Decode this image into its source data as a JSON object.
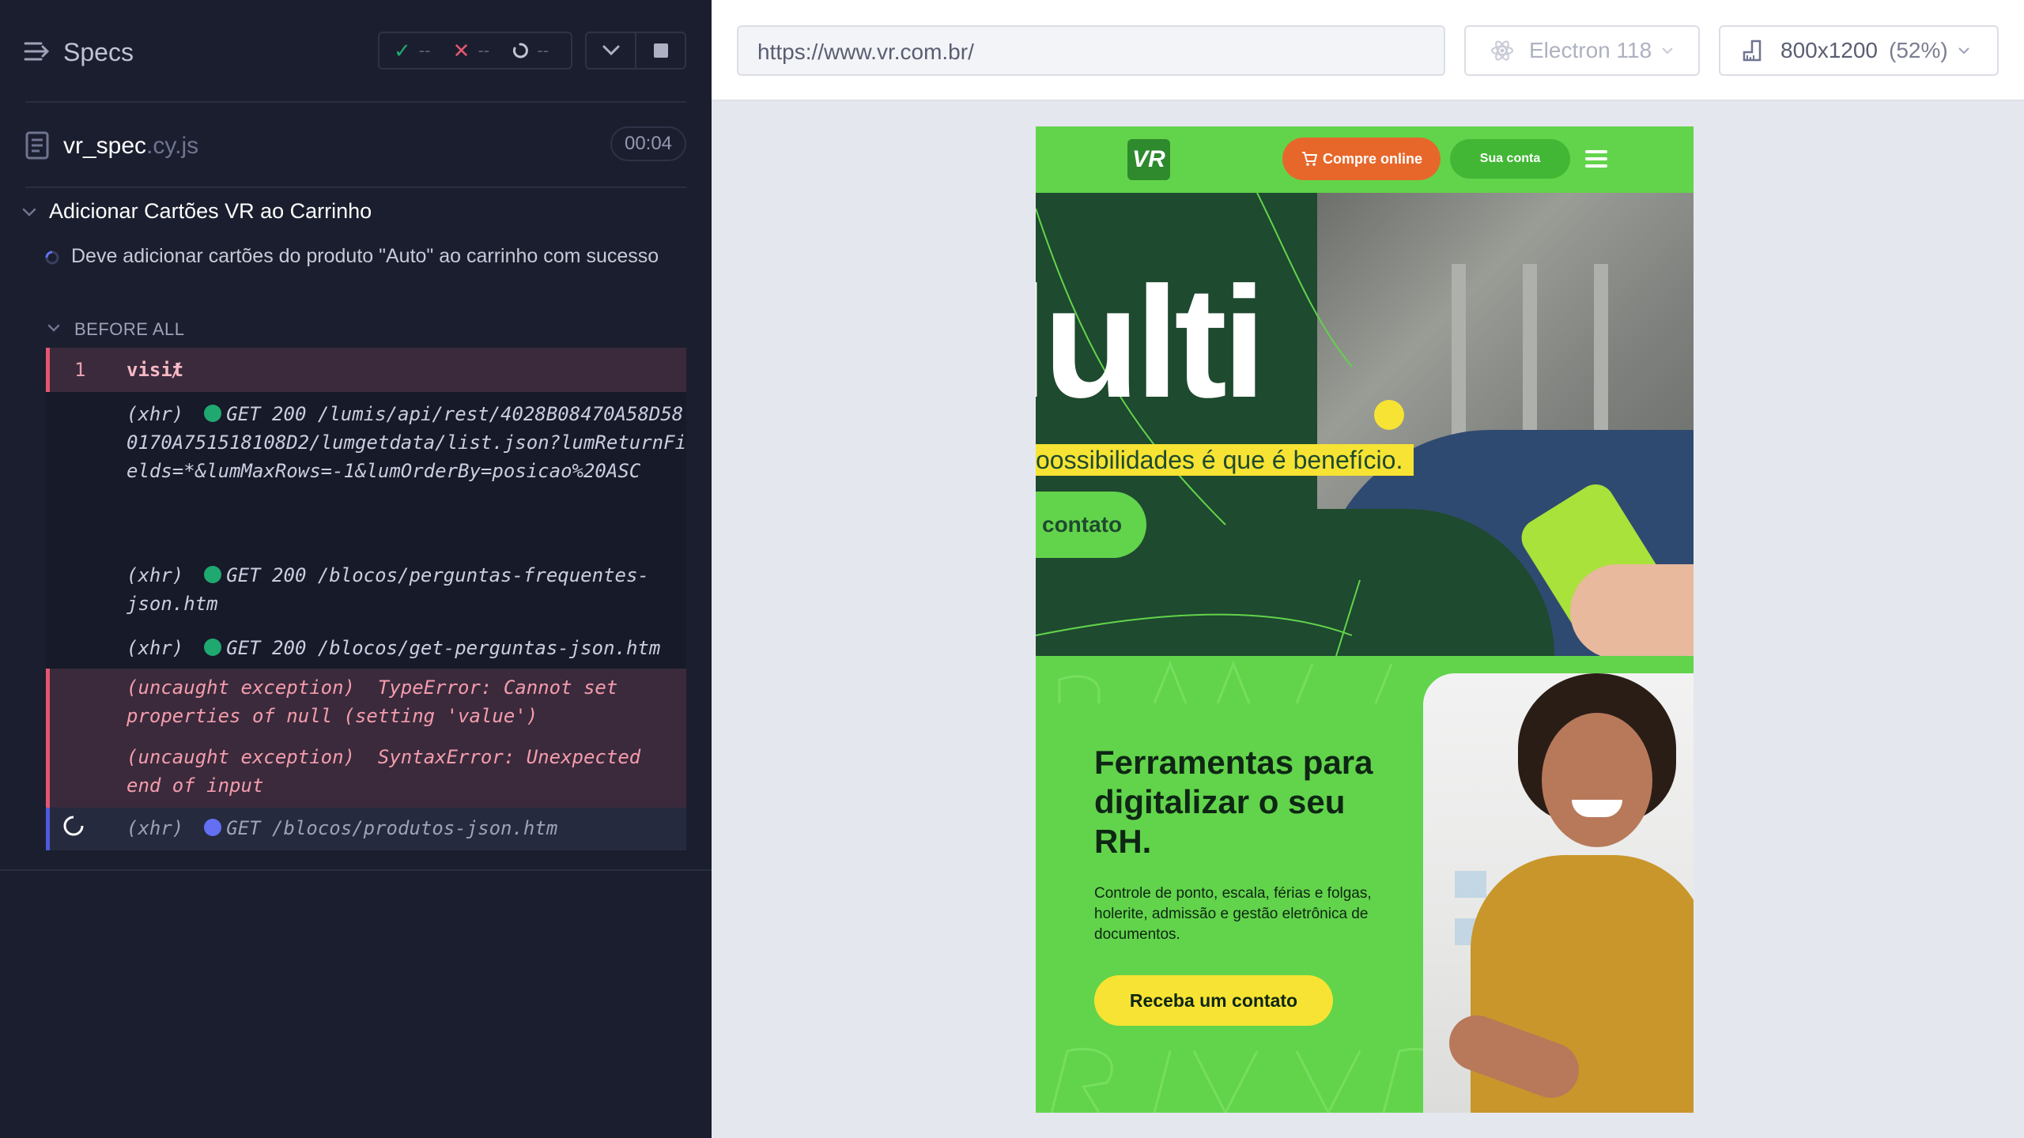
{
  "reporter": {
    "header": {
      "title": "Specs",
      "passed": "--",
      "failed": "--",
      "pending": "--"
    },
    "file": {
      "name": "vr_spec",
      "ext": ".cy.js",
      "duration": "00:04"
    },
    "suite": {
      "title": "Adicionar Cartões VR ao Carrinho"
    },
    "test": {
      "title": "Deve adicionar cartões do produto \"Auto\" ao carrinho com sucesso"
    },
    "hook": {
      "title": "BEFORE ALL"
    },
    "commands": [
      {
        "num": "1",
        "name": "visit",
        "message": "/"
      },
      {
        "name": "(xhr)",
        "method": "GET 200",
        "message": "/lumis/api/rest/4028B08470A58D580170A751518108D2/lumgetdata/list.json?lumReturnFields=*&lumMaxRows=-1&lumOrderBy=posicao%20ASC"
      },
      {
        "name": "(xhr)",
        "method": "GET 200 /blocos/perguntas-frequentes-json.htm"
      },
      {
        "name": "(xhr)",
        "method": "GET 200 /blocos/get-perguntas-json.htm"
      },
      {
        "name": "(uncaught exception)",
        "message": "TypeError: Cannot set properties of null (setting 'value')"
      },
      {
        "name": "(uncaught exception)",
        "message": "SyntaxError: Unexpected end of input"
      },
      {
        "name": "(xhr)",
        "method": "GET /blocos/produtos-json.htm"
      }
    ]
  },
  "preview": {
    "url": "https://www.vr.com.br/",
    "browser": "Electron 118",
    "viewport": "800x1200",
    "scale": "(52%)",
    "site": {
      "logo": "VR",
      "compre_label": "Compre online",
      "conta_label": "Sua conta",
      "hero_big": "lulti",
      "hero_dot": ".",
      "hero_tag": "oossibilidades é que é benefício.",
      "hero_cta": "contato",
      "rh_title": "Ferramentas para digitalizar o seu RH.",
      "rh_text": "Controle de ponto, escala, férias e folgas, holerite, admissão e gestão eletrônica de documentos.",
      "rh_cta": "Receba um contato"
    }
  },
  "colors": {
    "reporter_bg": "#1b1e2e",
    "pass": "#1fa971",
    "fail": "#e45770",
    "pending": "#6470f3",
    "vr_green": "#62d44b",
    "vr_dark": "#1e4a2f",
    "vr_yellow": "#f7e333",
    "vr_orange": "#e7672a"
  }
}
